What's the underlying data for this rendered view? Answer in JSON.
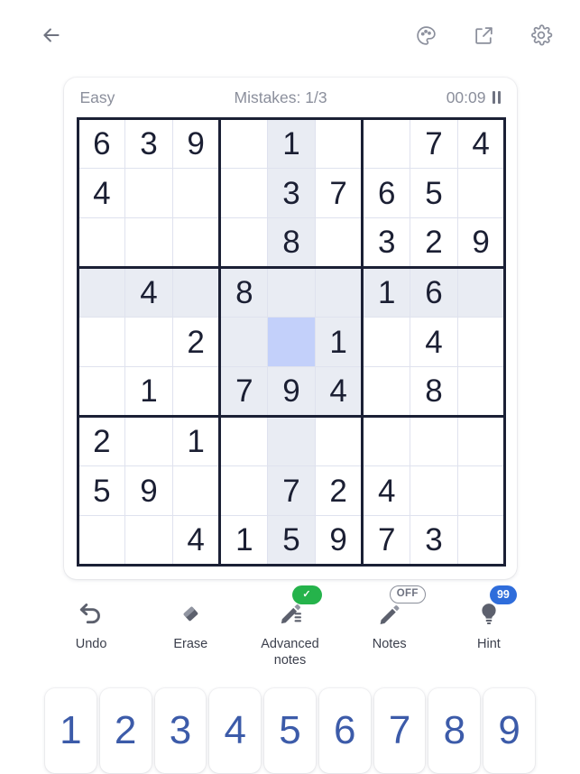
{
  "header": {
    "back_icon": "back-arrow-icon",
    "theme_icon": "palette-icon",
    "share_icon": "external-link-icon",
    "settings_icon": "gear-icon"
  },
  "status": {
    "difficulty": "Easy",
    "mistakes": "Mistakes: 1/3",
    "timer": "00:09",
    "pause_icon": "pause-icon"
  },
  "board": {
    "selected_cell": {
      "row": 5,
      "col": 5
    },
    "colors": {
      "highlight": "#e9ecf3",
      "selection": "#c3d0fa",
      "given_digit": "#1b1f33",
      "grid_line": "#1b2035"
    },
    "rows": [
      [
        "6",
        "3",
        "9",
        "",
        "1",
        "",
        "",
        "7",
        "4"
      ],
      [
        "4",
        "",
        "",
        "",
        "3",
        "7",
        "6",
        "5",
        ""
      ],
      [
        "",
        "",
        "",
        "",
        "8",
        "",
        "3",
        "2",
        "9"
      ],
      [
        "",
        "4",
        "",
        "8",
        "",
        "",
        "1",
        "6",
        ""
      ],
      [
        "",
        "",
        "2",
        "",
        "",
        "1",
        "",
        "4",
        ""
      ],
      [
        "",
        "1",
        "",
        "7",
        "9",
        "4",
        "",
        "8",
        ""
      ],
      [
        "2",
        "",
        "1",
        "",
        "",
        "",
        "",
        "",
        ""
      ],
      [
        "5",
        "9",
        "",
        "",
        "7",
        "2",
        "4",
        "",
        ""
      ],
      [
        "",
        "",
        "4",
        "1",
        "5",
        "9",
        "7",
        "3",
        ""
      ]
    ],
    "highlight": [
      [
        0,
        0,
        0,
        0,
        1,
        0,
        0,
        0,
        0
      ],
      [
        0,
        0,
        0,
        0,
        1,
        0,
        0,
        0,
        0
      ],
      [
        0,
        0,
        0,
        0,
        1,
        0,
        0,
        0,
        0
      ],
      [
        1,
        1,
        1,
        1,
        1,
        1,
        1,
        1,
        1
      ],
      [
        0,
        0,
        0,
        1,
        2,
        1,
        0,
        0,
        0
      ],
      [
        0,
        0,
        0,
        1,
        1,
        1,
        0,
        0,
        0
      ],
      [
        0,
        0,
        0,
        0,
        1,
        0,
        0,
        0,
        0
      ],
      [
        0,
        0,
        0,
        0,
        1,
        0,
        0,
        0,
        0
      ],
      [
        0,
        0,
        0,
        0,
        1,
        0,
        0,
        0,
        0
      ]
    ]
  },
  "tools": [
    {
      "label": "Undo",
      "icon": "undo-icon",
      "badge": null,
      "badge_type": null
    },
    {
      "label": "Erase",
      "icon": "eraser-icon",
      "badge": null,
      "badge_type": null
    },
    {
      "label": "Advanced\nnotes",
      "icon": "advanced-notes-icon",
      "badge": "✓",
      "badge_type": "check"
    },
    {
      "label": "Notes",
      "icon": "pencil-icon",
      "badge": "OFF",
      "badge_type": "off"
    },
    {
      "label": "Hint",
      "icon": "lightbulb-icon",
      "badge": "99",
      "badge_type": "count"
    }
  ],
  "numpad": {
    "digits": [
      "1",
      "2",
      "3",
      "4",
      "5",
      "6",
      "7",
      "8",
      "9"
    ],
    "digit_color": "#3c5ba9"
  }
}
